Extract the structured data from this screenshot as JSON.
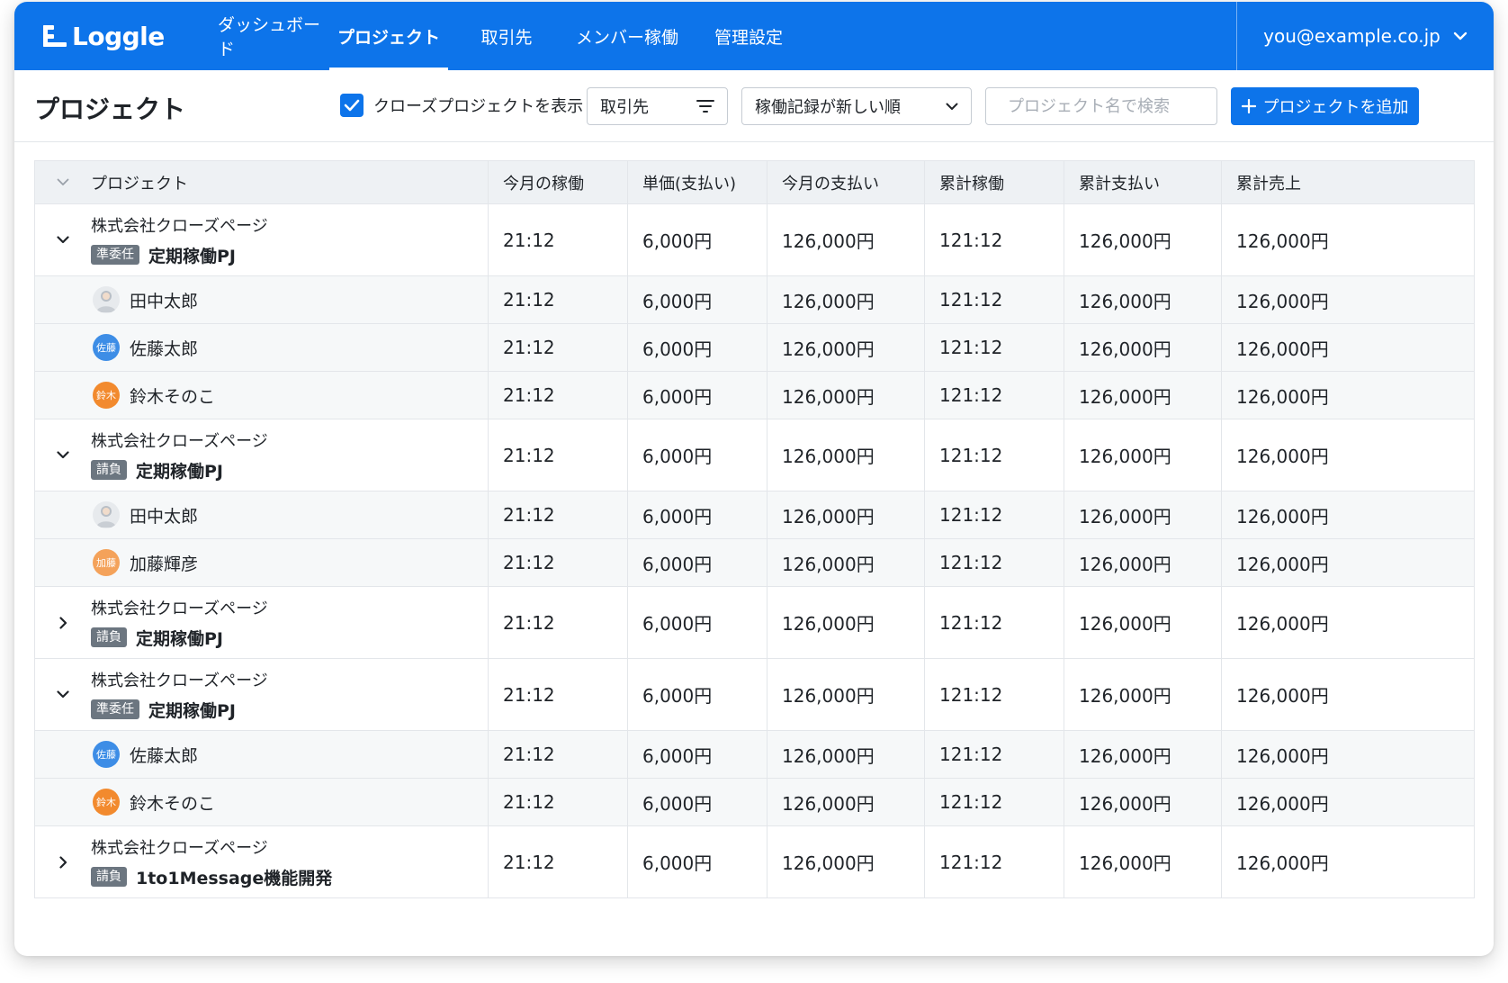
{
  "app": {
    "name": "Loggle",
    "nav": [
      {
        "label": "ダッシュボード",
        "active": false
      },
      {
        "label": "プロジェクト",
        "active": true
      },
      {
        "label": "取引先",
        "active": false
      },
      {
        "label": "メンバー稼働",
        "active": false
      },
      {
        "label": "管理設定",
        "active": false
      }
    ],
    "account_email": "you@example.co.jp"
  },
  "toolbar": {
    "title": "プロジェクト",
    "show_closed_label": "クローズプロジェクトを表示",
    "show_closed_checked": true,
    "client_filter": "取引先",
    "sort_value": "稼働記録が新しい順",
    "search_placeholder": "プロジェクト名で検索",
    "add_button": "プロジェクトを追加"
  },
  "table": {
    "columns": [
      "プロジェクト",
      "今月の稼働",
      "単価(支払い)",
      "今月の支払い",
      "累計稼働",
      "累計支払い",
      "累計売上"
    ],
    "rows": [
      {
        "type": "project",
        "expanded": true,
        "client": "株式会社クローズページ",
        "badge": "準委任",
        "name": "定期稼働PJ",
        "values": [
          "21:12",
          "6,000円",
          "126,000円",
          "121:12",
          "126,000円",
          "126,000円"
        ]
      },
      {
        "type": "member",
        "avatar": "photo",
        "initials": "",
        "name": "田中太郎",
        "values": [
          "21:12",
          "6,000円",
          "126,000円",
          "121:12",
          "126,000円",
          "126,000円"
        ]
      },
      {
        "type": "member",
        "avatar": "blue",
        "initials": "佐藤",
        "name": "佐藤太郎",
        "values": [
          "21:12",
          "6,000円",
          "126,000円",
          "121:12",
          "126,000円",
          "126,000円"
        ]
      },
      {
        "type": "member",
        "avatar": "orange",
        "initials": "鈴木",
        "name": "鈴木そのこ",
        "values": [
          "21:12",
          "6,000円",
          "126,000円",
          "121:12",
          "126,000円",
          "126,000円"
        ]
      },
      {
        "type": "project",
        "expanded": true,
        "client": "株式会社クローズページ",
        "badge": "請負",
        "name": "定期稼働PJ",
        "values": [
          "21:12",
          "6,000円",
          "126,000円",
          "121:12",
          "126,000円",
          "126,000円"
        ]
      },
      {
        "type": "member",
        "avatar": "photo",
        "initials": "",
        "name": "田中太郎",
        "values": [
          "21:12",
          "6,000円",
          "126,000円",
          "121:12",
          "126,000円",
          "126,000円"
        ]
      },
      {
        "type": "member",
        "avatar": "peach",
        "initials": "加藤",
        "name": "加藤輝彦",
        "values": [
          "21:12",
          "6,000円",
          "126,000円",
          "121:12",
          "126,000円",
          "126,000円"
        ]
      },
      {
        "type": "project",
        "expanded": false,
        "client": "株式会社クローズページ",
        "badge": "請負",
        "name": "定期稼働PJ",
        "values": [
          "21:12",
          "6,000円",
          "126,000円",
          "121:12",
          "126,000円",
          "126,000円"
        ]
      },
      {
        "type": "project",
        "expanded": true,
        "client": "株式会社クローズページ",
        "badge": "準委任",
        "name": "定期稼働PJ",
        "values": [
          "21:12",
          "6,000円",
          "126,000円",
          "121:12",
          "126,000円",
          "126,000円"
        ]
      },
      {
        "type": "member",
        "avatar": "blue",
        "initials": "佐藤",
        "name": "佐藤太郎",
        "values": [
          "21:12",
          "6,000円",
          "126,000円",
          "121:12",
          "126,000円",
          "126,000円"
        ]
      },
      {
        "type": "member",
        "avatar": "orange",
        "initials": "鈴木",
        "name": "鈴木そのこ",
        "values": [
          "21:12",
          "6,000円",
          "126,000円",
          "121:12",
          "126,000円",
          "126,000円"
        ]
      },
      {
        "type": "project",
        "expanded": false,
        "client": "株式会社クローズページ",
        "badge": "請負",
        "name": "1to1Message機能開発",
        "values": [
          "21:12",
          "6,000円",
          "126,000円",
          "121:12",
          "126,000円",
          "126,000円"
        ]
      }
    ]
  },
  "colors": {
    "brand": "#0d74ea",
    "badge": "#6c7680",
    "header_row": "#eef1f4",
    "member_row": "#f6f8f9"
  }
}
